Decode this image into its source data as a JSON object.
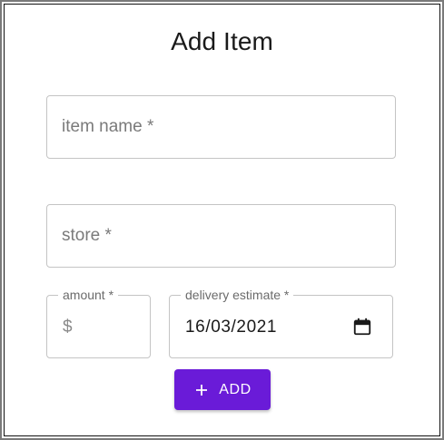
{
  "form": {
    "title": "Add Item",
    "item_name": {
      "placeholder": "item name *",
      "value": ""
    },
    "store": {
      "placeholder": "store *",
      "value": ""
    },
    "amount": {
      "label": "amount *",
      "adornment": "$",
      "value": ""
    },
    "delivery_estimate": {
      "label": "delivery estimate *",
      "value": "16/03/2021",
      "icon": "calendar-icon"
    },
    "add_button": {
      "label": "ADD",
      "icon": "plus-icon",
      "color": "#6a1bd8"
    }
  }
}
